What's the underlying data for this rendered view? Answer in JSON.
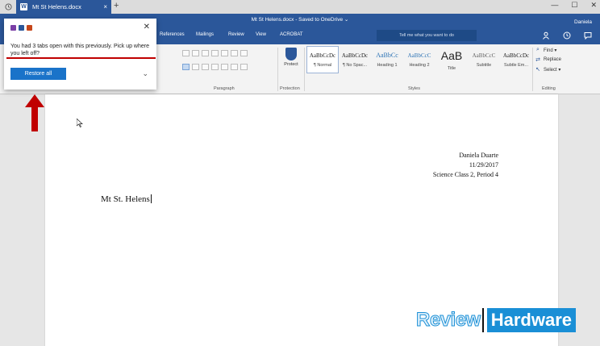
{
  "browser": {
    "tab_title": "Mt St Helens.docx",
    "tab_close": "×",
    "new_tab": "+",
    "window_controls": [
      "—",
      "☐",
      "✕"
    ]
  },
  "word": {
    "doc_title": "Mt St Helens.docx - Saved to OneDrive ⌄",
    "user_name": "Daniela",
    "menu": [
      "References",
      "Mailings",
      "Review",
      "View",
      "ACROBAT"
    ],
    "tell_me_placeholder": "Tell me what you want to do",
    "groups": {
      "paragraph": "Paragraph",
      "protection": "Protection",
      "styles": "Styles",
      "editing": "Editing"
    },
    "protect_label": "Protect",
    "styles": [
      {
        "sample": "AaBbCcDc",
        "name": "¶ Normal",
        "selected": true
      },
      {
        "sample": "AaBbCcDc",
        "name": "¶ No Spac..."
      },
      {
        "sample": "AaBbCc",
        "name": "Heading 1"
      },
      {
        "sample": "AaBbCcC",
        "name": "Heading 2"
      },
      {
        "sample": "AaB",
        "name": "Title"
      },
      {
        "sample": "AaBbCcC",
        "name": "Subtitle"
      },
      {
        "sample": "AaBbCcDc",
        "name": "Subtle Em..."
      }
    ],
    "editing": {
      "find": "Find ▾",
      "replace": "Replace",
      "select": "Select ▾"
    }
  },
  "document": {
    "header_lines": [
      "Daniela Duarte",
      "11/29/2017",
      "Science Class 2, Period 4"
    ],
    "heading": "Mt St. Helens"
  },
  "popup": {
    "message": "You had 3 tabs open with this previously. Pick up where you left off?",
    "restore_button": "Restore all",
    "close": "✕",
    "chevron": "⌄"
  },
  "watermark": {
    "left": "Review",
    "right": "Hardware"
  },
  "colors": {
    "word_blue": "#2b579a",
    "button_blue": "#1a73c9",
    "annotation_red": "#c00000"
  }
}
